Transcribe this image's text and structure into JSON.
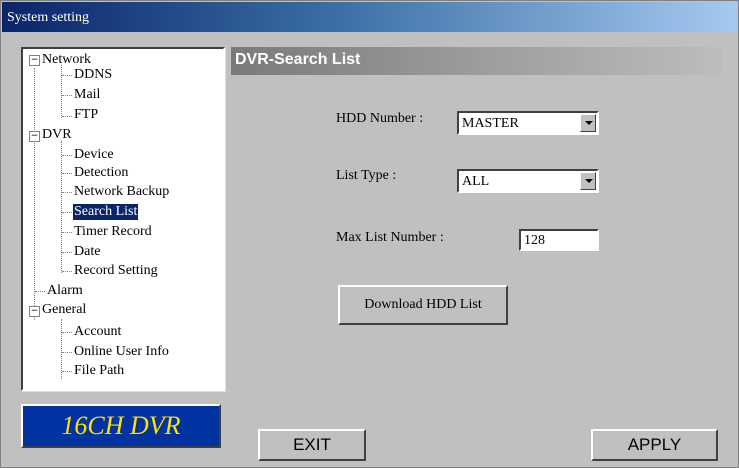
{
  "window": {
    "title": "System setting"
  },
  "tree": {
    "network": {
      "label": "Network",
      "expander": "−",
      "children": [
        "DDNS",
        "Mail",
        "FTP"
      ]
    },
    "dvr": {
      "label": "DVR",
      "expander": "−",
      "children": [
        "Device",
        "Detection",
        "Network Backup",
        "Search List",
        "Timer Record",
        "Date",
        "Record Setting"
      ]
    },
    "alarm": {
      "label": "Alarm"
    },
    "general": {
      "label": "General",
      "expander": "−",
      "children": [
        "Account",
        "Online User Info",
        "File Path"
      ]
    },
    "selected": "Search List"
  },
  "logo": {
    "text": "16CH DVR"
  },
  "panel": {
    "title": "DVR-Search List",
    "hdd_number": {
      "label": "HDD Number :",
      "value": "MASTER"
    },
    "list_type": {
      "label": "List Type :",
      "value": "ALL"
    },
    "max_list_number": {
      "label": "Max List Number :",
      "value": "128"
    },
    "download_button": "Download HDD List"
  },
  "footer": {
    "exit": "EXIT",
    "apply": "APPLY"
  },
  "colors": {
    "title_gradient_start": "#0a246a",
    "selection": "#0a246a",
    "logo_bg": "#0033a0",
    "logo_text": "#ffe000"
  }
}
